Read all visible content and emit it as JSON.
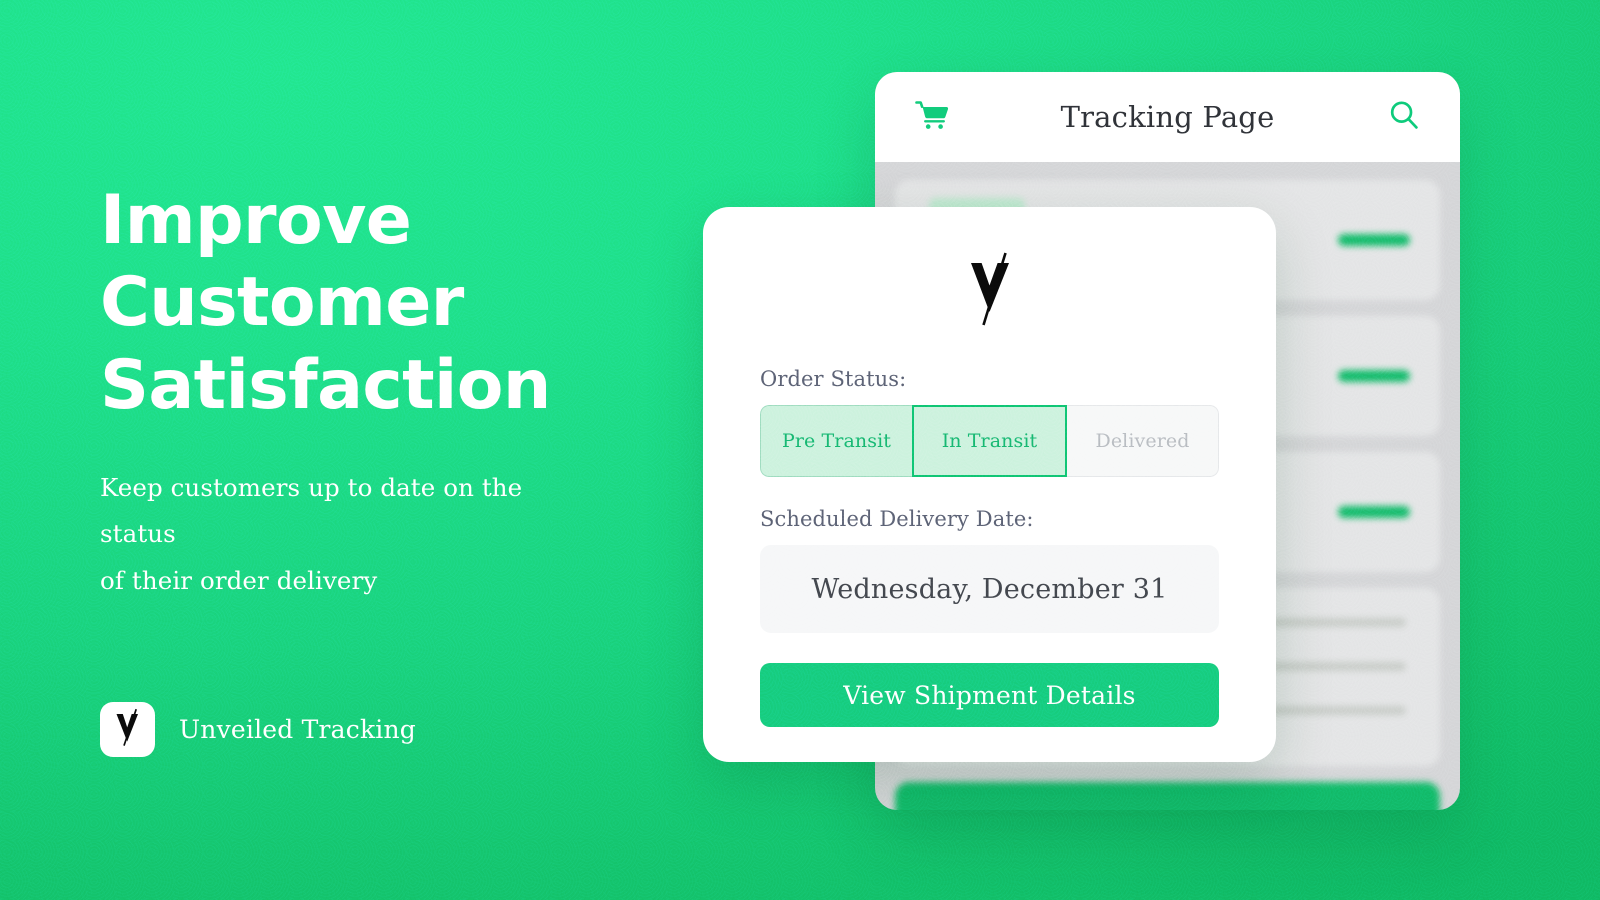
{
  "theme": {
    "bg_green_light": "#22E791",
    "bg_green_dark": "#10BA65",
    "accent_green": "#17CD80",
    "status_green": "#17B872",
    "muted_gray": "#B9BDC2"
  },
  "hero": {
    "headline": "Improve\nCustomer\nSatisfaction",
    "subheadline": "Keep customers up to date on the status\nof their order delivery",
    "brand_name": "Unveiled Tracking",
    "brand_logo_icon": "unveiled-v-slash-logo"
  },
  "phone": {
    "header": {
      "cart_icon": "shopping-cart-icon",
      "title": "Tracking Page",
      "search_icon": "search-icon"
    },
    "background_cards": [
      {
        "type": "row",
        "has_chip": true,
        "gray_bar": true,
        "green_bar": true
      },
      {
        "type": "row",
        "has_chip": false,
        "gray_bar": true,
        "green_bar": true
      },
      {
        "type": "row",
        "has_chip": false,
        "gray_bar": true,
        "green_bar": true
      },
      {
        "type": "list",
        "lines": 3
      }
    ],
    "bottom_cta": ""
  },
  "modal": {
    "logo_icon": "unveiled-v-slash-logo",
    "order_status_label": "Order Status:",
    "status_steps": [
      {
        "label": "Pre Transit",
        "state": "done"
      },
      {
        "label": "In Transit",
        "state": "current"
      },
      {
        "label": "Delivered",
        "state": "pending"
      }
    ],
    "delivery_date_label": "Scheduled Delivery Date:",
    "delivery_date_value": "Wednesday, December 31",
    "cta_label": "View Shipment Details"
  }
}
